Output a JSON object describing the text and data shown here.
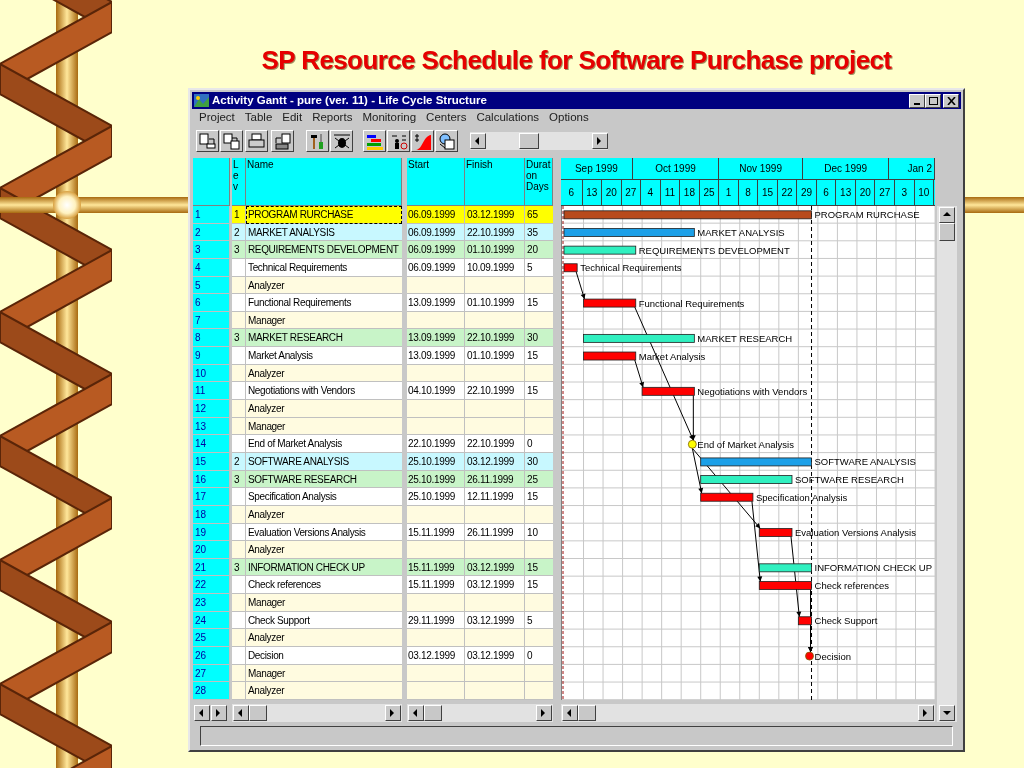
{
  "slide_title": "SP Resource Schedule for Software Purchase project",
  "window": {
    "title": "Activity Gantt - pure (ver. 11) - Life Cycle Structure"
  },
  "menu": [
    "Project",
    "Table",
    "Edit",
    "Reports",
    "Monitoring",
    "Centers",
    "Calculations",
    "Options"
  ],
  "table": {
    "columns": {
      "level": "Lev",
      "name": "Name",
      "start": "Start",
      "finish": "Finish",
      "duration": "Durat on Days"
    },
    "rows": [
      {
        "num": "1",
        "kind": "project",
        "level": "1",
        "name": "PROGRAM RURCHASE",
        "start": "06.09.1999",
        "finish": "03.12.1999",
        "days": "65",
        "selected": true,
        "bar": {
          "kind": "bar",
          "color": "#b84a1c"
        },
        "chart_label": "PROGRAM RURCHASE"
      },
      {
        "num": "2",
        "kind": "phase",
        "level": "2",
        "name": "MARKET ANALYSIS",
        "start": "06.09.1999",
        "finish": "22.10.1999",
        "days": "35",
        "selected": false,
        "bar": {
          "kind": "bar",
          "color": "#1ca0e8"
        },
        "chart_label": "MARKET ANALYSIS"
      },
      {
        "num": "3",
        "kind": "stage",
        "level": "3",
        "name": "REQUIREMENTS DEVELOPMENT",
        "start": "06.09.1999",
        "finish": "01.10.1999",
        "days": "20",
        "selected": false,
        "bar": {
          "kind": "bar",
          "color": "#30f0c0"
        },
        "chart_label": "REQUIREMENTS DEVELOPMENT"
      },
      {
        "num": "4",
        "kind": "task",
        "name": "Technical Requirements",
        "start": "06.09.1999",
        "finish": "10.09.1999",
        "days": "5",
        "selected": false,
        "bar": {
          "kind": "bar",
          "color": "#ff0000"
        },
        "chart_label": "Technical Requirements"
      },
      {
        "num": "5",
        "kind": "resource",
        "name": "Analyzer",
        "selected": false
      },
      {
        "num": "6",
        "kind": "task",
        "name": "Functional Requirements",
        "start": "13.09.1999",
        "finish": "01.10.1999",
        "days": "15",
        "selected": false,
        "bar": {
          "kind": "bar",
          "color": "#ff0000"
        },
        "chart_label": "Functional Requirements"
      },
      {
        "num": "7",
        "kind": "resource",
        "name": "Manager",
        "selected": false
      },
      {
        "num": "8",
        "kind": "stage",
        "level": "3",
        "name": "MARKET RESEARCH",
        "start": "13.09.1999",
        "finish": "22.10.1999",
        "days": "30",
        "selected": false,
        "bar": {
          "kind": "bar",
          "color": "#30f0c0"
        },
        "chart_label": "MARKET RESEARCH"
      },
      {
        "num": "9",
        "kind": "task",
        "name": "Market Analysis",
        "start": "13.09.1999",
        "finish": "01.10.1999",
        "days": "15",
        "selected": false,
        "bar": {
          "kind": "bar",
          "color": "#ff0000"
        },
        "chart_label": "Market Analysis"
      },
      {
        "num": "10",
        "kind": "resource",
        "name": "Analyzer",
        "selected": false
      },
      {
        "num": "11",
        "kind": "task",
        "name": "Negotiations with Vendors",
        "start": "04.10.1999",
        "finish": "22.10.1999",
        "days": "15",
        "selected": false,
        "bar": {
          "kind": "bar",
          "color": "#ff0000"
        },
        "chart_label": "Negotiations with Vendors"
      },
      {
        "num": "12",
        "kind": "resource",
        "name": "Analyzer",
        "selected": false
      },
      {
        "num": "13",
        "kind": "resource",
        "name": "Manager",
        "selected": false
      },
      {
        "num": "14",
        "kind": "task",
        "name": "End of Market Analysis",
        "start": "22.10.1999",
        "finish": "22.10.1999",
        "days": "0",
        "selected": false,
        "bar": {
          "kind": "milestone",
          "color": "#ffff00"
        },
        "chart_label": "End of Market Analysis"
      },
      {
        "num": "15",
        "kind": "phase",
        "level": "2",
        "name": "SOFTWARE ANALYSIS",
        "start": "25.10.1999",
        "finish": "03.12.1999",
        "days": "30",
        "selected": false,
        "bar": {
          "kind": "bar",
          "color": "#1ca0e8"
        },
        "chart_label": "SOFTWARE ANALYSIS"
      },
      {
        "num": "16",
        "kind": "stage",
        "level": "3",
        "name": "SOFTWARE RESEARCH",
        "start": "25.10.1999",
        "finish": "26.11.1999",
        "days": "25",
        "selected": false,
        "bar": {
          "kind": "bar",
          "color": "#30f0c0"
        },
        "chart_label": "SOFTWARE RESEARCH"
      },
      {
        "num": "17",
        "kind": "task",
        "name": "Specification Analysis",
        "start": "25.10.1999",
        "finish": "12.11.1999",
        "days": "15",
        "selected": false,
        "bar": {
          "kind": "bar",
          "color": "#ff0000"
        },
        "chart_label": "Specification Analysis"
      },
      {
        "num": "18",
        "kind": "resource",
        "name": "Analyzer",
        "selected": false
      },
      {
        "num": "19",
        "kind": "task",
        "name": "Evaluation Versions Analysis",
        "start": "15.11.1999",
        "finish": "26.11.1999",
        "days": "10",
        "selected": false,
        "bar": {
          "kind": "bar",
          "color": "#ff0000"
        },
        "chart_label": "Evaluation Versions Analysis"
      },
      {
        "num": "20",
        "kind": "resource",
        "name": "Analyzer",
        "selected": false
      },
      {
        "num": "21",
        "kind": "stage",
        "level": "3",
        "name": "INFORMATION CHECK UP",
        "start": "15.11.1999",
        "finish": "03.12.1999",
        "days": "15",
        "selected": false,
        "bar": {
          "kind": "bar",
          "color": "#30f0c0"
        },
        "chart_label": "INFORMATION CHECK UP"
      },
      {
        "num": "22",
        "kind": "task",
        "name": "Check references",
        "start": "15.11.1999",
        "finish": "03.12.1999",
        "days": "15",
        "selected": false,
        "bar": {
          "kind": "bar",
          "color": "#ff0000"
        },
        "chart_label": "Check references"
      },
      {
        "num": "23",
        "kind": "resource",
        "name": "Manager",
        "selected": false
      },
      {
        "num": "24",
        "kind": "task",
        "name": "Check Support",
        "start": "29.11.1999",
        "finish": "03.12.1999",
        "days": "5",
        "selected": false,
        "bar": {
          "kind": "bar",
          "color": "#ff0000"
        },
        "chart_label": "Check Support"
      },
      {
        "num": "25",
        "kind": "resource",
        "name": "Analyzer",
        "selected": false
      },
      {
        "num": "26",
        "kind": "task",
        "name": "Decision",
        "start": "03.12.1999",
        "finish": "03.12.1999",
        "days": "0",
        "selected": false,
        "bar": {
          "kind": "milestone",
          "color": "#ff0000"
        },
        "chart_label": "Decision"
      },
      {
        "num": "27",
        "kind": "resource",
        "name": "Manager",
        "selected": false
      },
      {
        "num": "28",
        "kind": "resource",
        "name": "Analyzer",
        "selected": false
      }
    ]
  },
  "gantt": {
    "months": [
      "Sep 1999",
      "Oct 1999",
      "Nov 1999",
      "Dec 1999",
      "Jan 2"
    ],
    "weeks": [
      "6",
      "13",
      "20",
      "27",
      "4",
      "11",
      "18",
      "25",
      "1",
      "8",
      "15",
      "22",
      "29",
      "6",
      "13",
      "20",
      "27",
      "3",
      "10"
    ]
  }
}
